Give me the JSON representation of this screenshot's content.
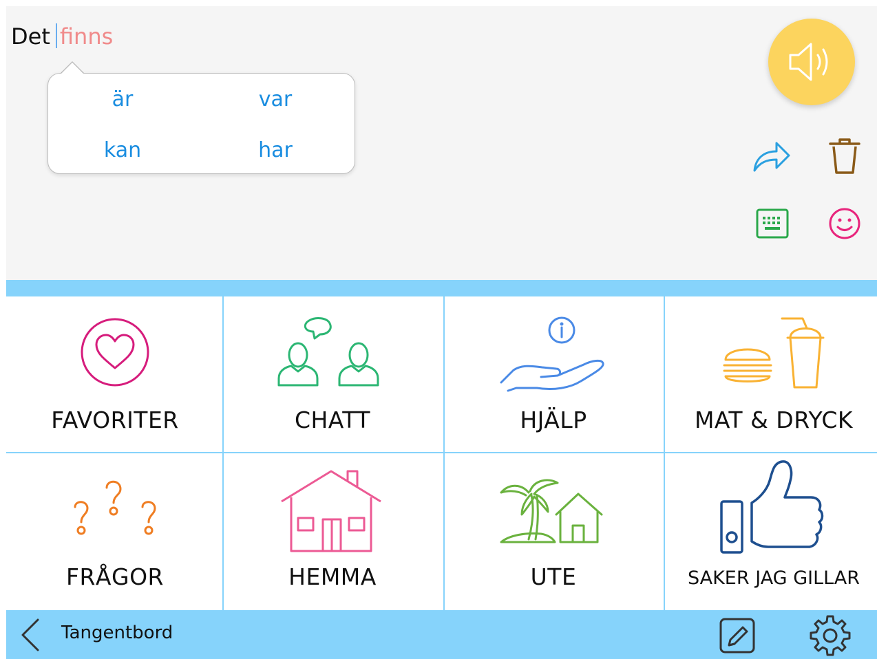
{
  "message": {
    "text": "Det",
    "pending_word": "finns"
  },
  "suggestions": {
    "items": [
      "är",
      "var",
      "kan",
      "har"
    ]
  },
  "toolbar": {
    "speak_icon": "speaker-icon",
    "share_icon": "share-arrow-icon",
    "delete_icon": "trash-icon",
    "keyboard_icon": "keyboard-icon",
    "emoji_icon": "smiley-icon"
  },
  "categories": [
    {
      "label": "FAVORITER",
      "icon": "heart-icon",
      "color": "#d61c7c"
    },
    {
      "label": "CHATT",
      "icon": "chat-people-icon",
      "color": "#2bb673"
    },
    {
      "label": "HJÄLP",
      "icon": "help-hand-icon",
      "color": "#4a8ae6"
    },
    {
      "label": "MAT & DRYCK",
      "icon": "burger-drink-icon",
      "color": "#f9b233"
    },
    {
      "label": "FRÅGOR",
      "icon": "question-marks-icon",
      "color": "#ef7d22"
    },
    {
      "label": "HEMMA",
      "icon": "house-icon",
      "color": "#ec5a94"
    },
    {
      "label": "UTE",
      "icon": "island-icon",
      "color": "#6ab23e"
    },
    {
      "label": "SAKER JAG GILLAR",
      "icon": "thumbs-up-icon",
      "color": "#1e4f8f"
    }
  ],
  "bottom_bar": {
    "title": "Tangentbord",
    "back_icon": "chevron-left-icon",
    "edit_icon": "pencil-icon",
    "settings_icon": "gear-icon"
  },
  "colors": {
    "accent_band": "#86d3fb",
    "speak_button": "#fcd45e",
    "suggestion_text": "#1a8de0",
    "pending_word": "#f08a8a"
  }
}
